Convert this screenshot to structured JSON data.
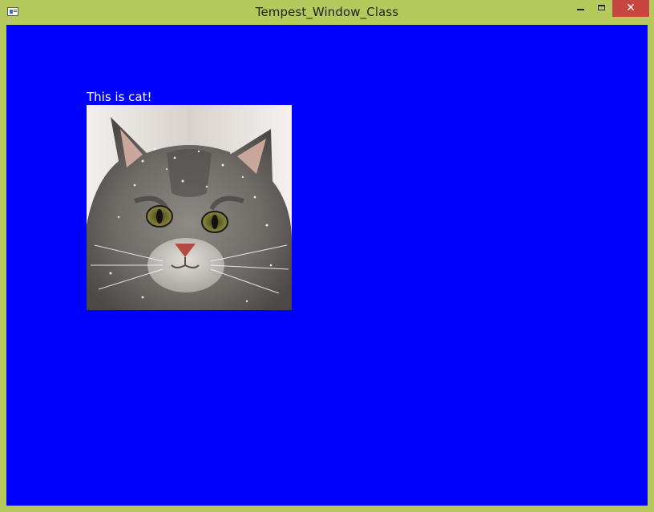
{
  "window": {
    "title": "Tempest_Window_Class",
    "client_background": "#0000ff",
    "frame_color": "#b6c95c",
    "close_button_color": "#c7453f"
  },
  "controls": {
    "minimize_icon": "minimize-icon",
    "maximize_icon": "maximize-icon",
    "close_glyph": "✕"
  },
  "content": {
    "caption": "This is cat!",
    "image_subject": "cat-photo"
  }
}
